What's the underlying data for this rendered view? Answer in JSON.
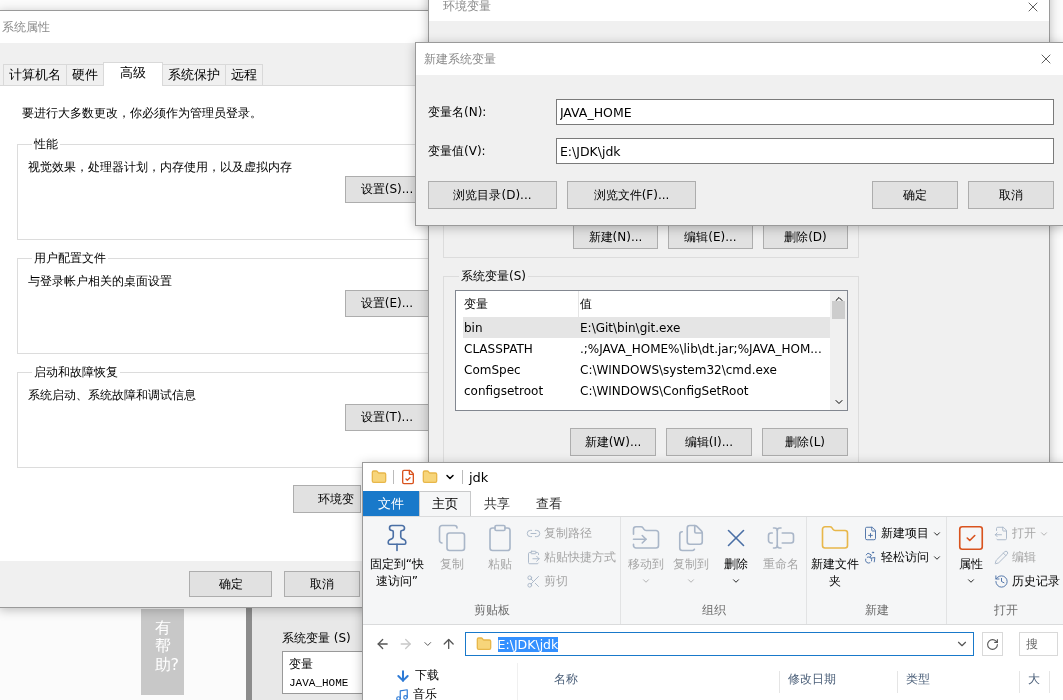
{
  "desktop": {
    "help_tab": "有帮助?",
    "back_window": {
      "group_label": "系统变量 (S)",
      "column": "变量",
      "row": "JAVA_HOME"
    }
  },
  "env_window": {
    "title": "环境变量",
    "user_buttons": [
      "新建(N)...",
      "编辑(E)...",
      "删除(D)"
    ],
    "system_vars": {
      "label": "系统变量(S)",
      "columns": [
        "变量",
        "值"
      ],
      "rows": [
        {
          "name": "bin",
          "value": "E:\\Git\\bin\\git.exe",
          "selected": true
        },
        {
          "name": "CLASSPATH",
          "value": ".;%JAVA_HOME%\\lib\\dt.jar;%JAVA_HOM...",
          "selected": false
        },
        {
          "name": "ComSpec",
          "value": "C:\\WINDOWS\\system32\\cmd.exe",
          "selected": false
        },
        {
          "name": "configsetroot",
          "value": "C:\\WINDOWS\\ConfigSetRoot",
          "selected": false
        }
      ],
      "buttons": [
        "新建(W)...",
        "编辑(I)...",
        "删除(L)"
      ]
    }
  },
  "system_properties": {
    "title": "系统属性",
    "tabs": [
      {
        "label": "计算机名",
        "selected": false
      },
      {
        "label": "硬件",
        "selected": false
      },
      {
        "label": "高级",
        "selected": true
      },
      {
        "label": "系统保护",
        "selected": false
      },
      {
        "label": "远程",
        "selected": false
      }
    ],
    "notice": "要进行大多数更改，你必须作为管理员登录。",
    "groups": [
      {
        "title": "性能",
        "description": "视觉效果，处理器计划，内存使用，以及虚拟内存",
        "button": "设置(S)..."
      },
      {
        "title": "用户配置文件",
        "description": "与登录帐户相关的桌面设置",
        "button": "设置(E)..."
      },
      {
        "title": "启动和故障恢复",
        "description": "系统启动、系统故障和调试信息",
        "button": "设置(T)..."
      }
    ],
    "env_button": "环境变",
    "buttons": [
      "确定",
      "取消"
    ]
  },
  "new_variable_dialog": {
    "title": "新建系统变量",
    "fields": [
      {
        "label": "变量名(N):",
        "value": "JAVA_HOME"
      },
      {
        "label": "变量值(V):",
        "value": "E:\\JDK\\jdk"
      }
    ],
    "browse_buttons": [
      "浏览目录(D)...",
      "浏览文件(F)..."
    ],
    "buttons": [
      "确定",
      "取消"
    ]
  },
  "explorer": {
    "title": "jdk",
    "tabs": [
      {
        "label": "文件",
        "kind": "file",
        "selected": false
      },
      {
        "label": "主页",
        "kind": "tab",
        "selected": true
      },
      {
        "label": "共享",
        "kind": "tab",
        "selected": false
      },
      {
        "label": "查看",
        "kind": "tab",
        "selected": false
      }
    ],
    "ribbon": [
      {
        "label": "剪贴板",
        "items": [
          {
            "kind": "large",
            "label": "固定到“快速访问”",
            "disabled": false,
            "dropdown": false
          },
          {
            "kind": "large",
            "label": "复制",
            "disabled": true,
            "dropdown": false
          },
          {
            "kind": "large",
            "label": "粘贴",
            "disabled": true,
            "dropdown": false
          },
          {
            "kind": "small",
            "label": "复制路径",
            "disabled": true,
            "dropdown": false
          },
          {
            "kind": "small",
            "label": "粘贴快捷方式",
            "disabled": true,
            "dropdown": false
          },
          {
            "kind": "small",
            "label": "剪切",
            "disabled": true,
            "dropdown": false
          }
        ]
      },
      {
        "label": "组织",
        "items": [
          {
            "kind": "large",
            "label": "移动到",
            "disabled": true,
            "dropdown": true
          },
          {
            "kind": "large",
            "label": "复制到",
            "disabled": true,
            "dropdown": true
          },
          {
            "kind": "large",
            "label": "删除",
            "disabled": false,
            "dropdown": true
          },
          {
            "kind": "large",
            "label": "重命名",
            "disabled": true,
            "dropdown": false
          }
        ]
      },
      {
        "label": "新建",
        "items": [
          {
            "kind": "large",
            "label": "新建文件夹",
            "disabled": false,
            "dropdown": false
          },
          {
            "kind": "small",
            "label": "新建项目",
            "disabled": false,
            "dropdown": true
          },
          {
            "kind": "small",
            "label": "轻松访问",
            "disabled": false,
            "dropdown": true
          }
        ]
      },
      {
        "label": "打开",
        "items": [
          {
            "kind": "large",
            "label": "属性",
            "disabled": false,
            "dropdown": true
          },
          {
            "kind": "small",
            "label": "打开",
            "disabled": true,
            "dropdown": true
          },
          {
            "kind": "small",
            "label": "编辑",
            "disabled": true,
            "dropdown": false
          },
          {
            "kind": "small",
            "label": "历史记录",
            "disabled": false,
            "dropdown": false
          }
        ]
      }
    ],
    "address": "E:\\JDK\\jdk",
    "search": "搜",
    "nav_items": [
      "下载",
      "音乐"
    ],
    "columns": [
      "名称",
      "修改日期",
      "类型",
      "大"
    ]
  }
}
